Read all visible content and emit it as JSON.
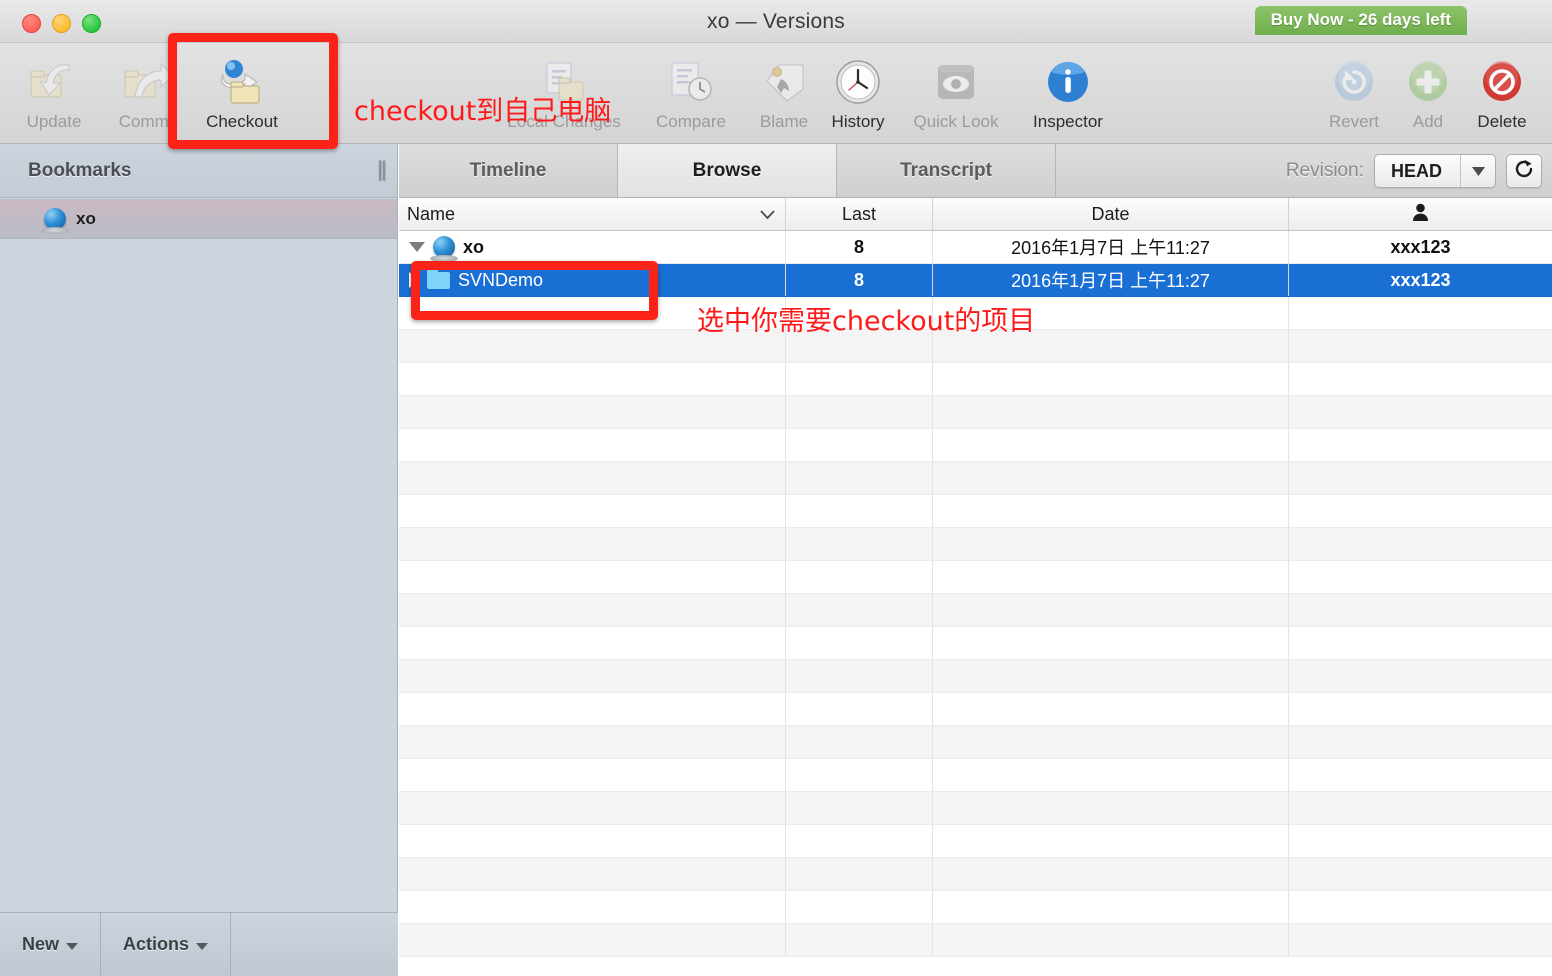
{
  "window": {
    "title": "xo — Versions",
    "buy_badge": "Buy Now - 26 days left"
  },
  "toolbar": {
    "items": [
      {
        "label": "Update",
        "icon": "update-icon",
        "enabled": false
      },
      {
        "label": "Commit",
        "icon": "commit-icon",
        "enabled": false
      },
      {
        "label": "Checkout",
        "icon": "checkout-icon",
        "enabled": true
      },
      {
        "label": "Local Changes",
        "icon": "local-changes-icon",
        "enabled": false
      },
      {
        "label": "Compare",
        "icon": "compare-icon",
        "enabled": false
      },
      {
        "label": "Blame",
        "icon": "blame-icon",
        "enabled": false
      },
      {
        "label": "History",
        "icon": "history-icon",
        "enabled": true
      },
      {
        "label": "Quick Look",
        "icon": "quick-look-icon",
        "enabled": false
      },
      {
        "label": "Inspector",
        "icon": "inspector-icon",
        "enabled": true
      },
      {
        "label": "Revert",
        "icon": "revert-icon",
        "enabled": false
      },
      {
        "label": "Add",
        "icon": "add-icon",
        "enabled": false
      },
      {
        "label": "Delete",
        "icon": "delete-icon",
        "enabled": true
      }
    ]
  },
  "annotations": {
    "checkout_note": "checkout到自己电脑",
    "select_note": "选中你需要checkout的项目",
    "color": "#ff1a1a"
  },
  "sidebar": {
    "title": "Bookmarks",
    "items": [
      {
        "label": "xo",
        "icon": "globe-icon",
        "selected": true
      }
    ],
    "footer": {
      "new_label": "New",
      "actions_label": "Actions"
    }
  },
  "main": {
    "tabs": [
      {
        "label": "Timeline",
        "active": false
      },
      {
        "label": "Browse",
        "active": true
      },
      {
        "label": "Transcript",
        "active": false
      }
    ],
    "revision": {
      "label": "Revision:",
      "value": "HEAD",
      "refresh_icon": "refresh-icon",
      "dropdown_icon": "chevron-down-icon"
    },
    "table": {
      "columns": [
        {
          "key": "name",
          "label": "Name",
          "sort_icon": "chevron-down-icon"
        },
        {
          "key": "last",
          "label": "Last"
        },
        {
          "key": "date",
          "label": "Date"
        },
        {
          "key": "author",
          "label": "",
          "icon": "person-icon"
        }
      ],
      "rows": [
        {
          "name": "xo",
          "last": "8",
          "date": "2016年1月7日 上午11:27",
          "author": "xxx123",
          "icon": "globe-icon",
          "disclosure": "down",
          "indent": 1,
          "selected": false
        },
        {
          "name": "SVNDemo",
          "last": "8",
          "date": "2016年1月7日 上午11:27",
          "author": "xxx123",
          "icon": "folder-icon",
          "disclosure": "right",
          "indent": 2,
          "selected": true
        }
      ],
      "empty_row_count": 20
    }
  }
}
